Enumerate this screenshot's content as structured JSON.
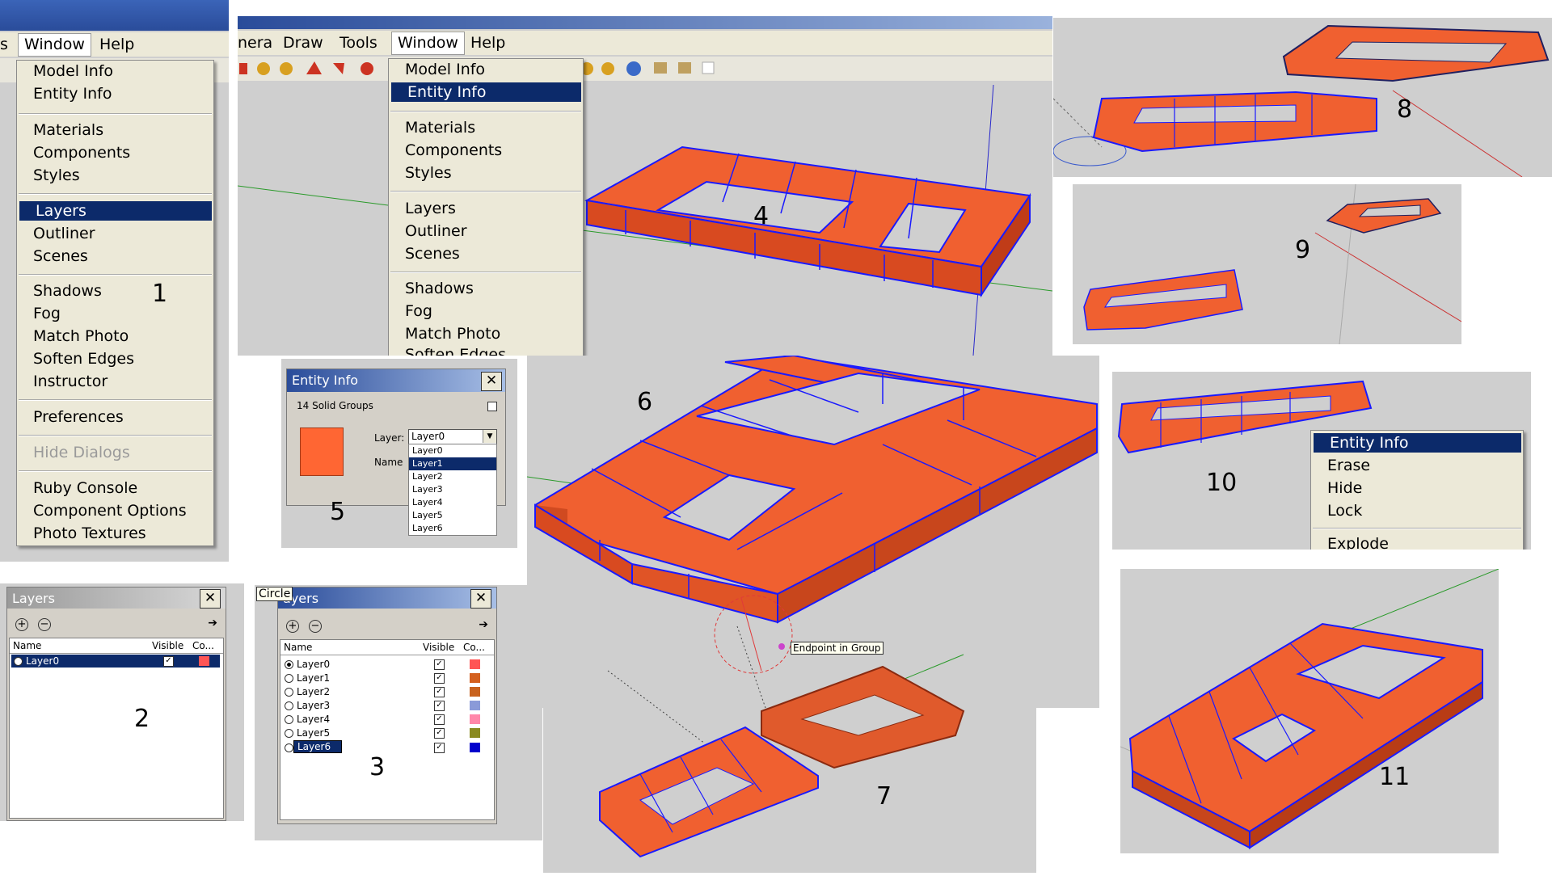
{
  "menu_bar_1": {
    "cut_item": "s",
    "window": "Window",
    "help": "Help"
  },
  "menu_bar_2": {
    "camera_partial": "nera",
    "draw": "Draw",
    "tools": "Tools",
    "window": "Window",
    "help": "Help"
  },
  "window_menu_1": {
    "items": [
      "Model Info",
      "Entity Info",
      "Materials",
      "Components",
      "Styles",
      "Layers",
      "Outliner",
      "Scenes",
      "Shadows",
      "Fog",
      "Match Photo",
      "Soften Edges",
      "Instructor",
      "Preferences",
      "Hide Dialogs",
      "Ruby Console",
      "Component Options",
      "Photo Textures"
    ],
    "selected": "Layers",
    "disabled": "Hide Dialogs"
  },
  "window_menu_2": {
    "items": [
      "Model Info",
      "Entity Info",
      "Materials",
      "Components",
      "Styles",
      "Layers",
      "Outliner",
      "Scenes",
      "Shadows",
      "Fog",
      "Match Photo",
      "Soften Edges"
    ],
    "selected": "Entity Info"
  },
  "entity_info": {
    "title": "Entity Info",
    "subtitle": "14 Solid Groups",
    "layer_label": "Layer:",
    "name_label": "Name",
    "layer_value": "Layer0",
    "swatch_color": "#ff6633",
    "layer_options": [
      "Layer0",
      "Layer1",
      "Layer2",
      "Layer3",
      "Layer4",
      "Layer5",
      "Layer6"
    ],
    "highlighted_option": "Layer1"
  },
  "layers_a": {
    "title": "Layers",
    "col_name": "Name",
    "col_visible": "Visible",
    "col_color": "Co...",
    "rows": [
      {
        "name": "Layer0",
        "visible": true,
        "color": "#ff5555"
      }
    ]
  },
  "layers_b": {
    "title": "ayers",
    "tooltip": "Circle",
    "col_name": "Name",
    "col_visible": "Visible",
    "col_color": "Co...",
    "rows": [
      {
        "name": "Layer0",
        "visible": true,
        "color": "#ff5555"
      },
      {
        "name": "Layer1",
        "visible": true,
        "color": "#d4601e"
      },
      {
        "name": "Layer2",
        "visible": true,
        "color": "#c8621e"
      },
      {
        "name": "Layer3",
        "visible": true,
        "color": "#8a9ad8"
      },
      {
        "name": "Layer4",
        "visible": true,
        "color": "#ff88aa"
      },
      {
        "name": "Layer5",
        "visible": true,
        "color": "#8a8a20"
      },
      {
        "name": "Layer6",
        "visible": true,
        "color": "#0000cc"
      }
    ]
  },
  "context_menu": {
    "items": [
      "Entity Info",
      "Erase",
      "Hide",
      "Lock",
      "Explode"
    ],
    "selected": "Entity Info"
  },
  "inference_tip": "Endpoint in Group",
  "step_numbers": [
    "1",
    "2",
    "3",
    "4",
    "5",
    "6",
    "7",
    "8",
    "9",
    "10",
    "11"
  ],
  "colors": {
    "brick": "#f06030",
    "edge": "#1a1aff",
    "xp_blue": "#0c2a6a",
    "viewport": "#cfcfcf"
  }
}
